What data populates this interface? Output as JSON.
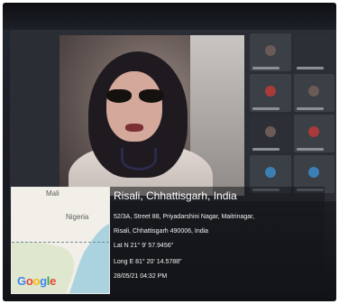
{
  "map": {
    "labels": [
      "Mali",
      "Nigeria"
    ],
    "logo_letters": [
      {
        "char": "G",
        "color": "#4285f4"
      },
      {
        "char": "o",
        "color": "#ea4335"
      },
      {
        "char": "o",
        "color": "#fbbc05"
      },
      {
        "char": "g",
        "color": "#4285f4"
      },
      {
        "char": "l",
        "color": "#34a853"
      },
      {
        "char": "e",
        "color": "#ea4335"
      }
    ]
  },
  "geo": {
    "title": "Risali, Chhattisgarh, India",
    "address_line1": "52/3A, Street 88, Priyadarshini Nagar, Maitrinagar,",
    "address_line2": "Risali, Chhattisgarh 490006, India",
    "lat": "Lat N 21° 9' 57.9456\"",
    "long": "Long E 81° 20' 14.5788\"",
    "datetime": "28/05/21 04:32 PM"
  }
}
